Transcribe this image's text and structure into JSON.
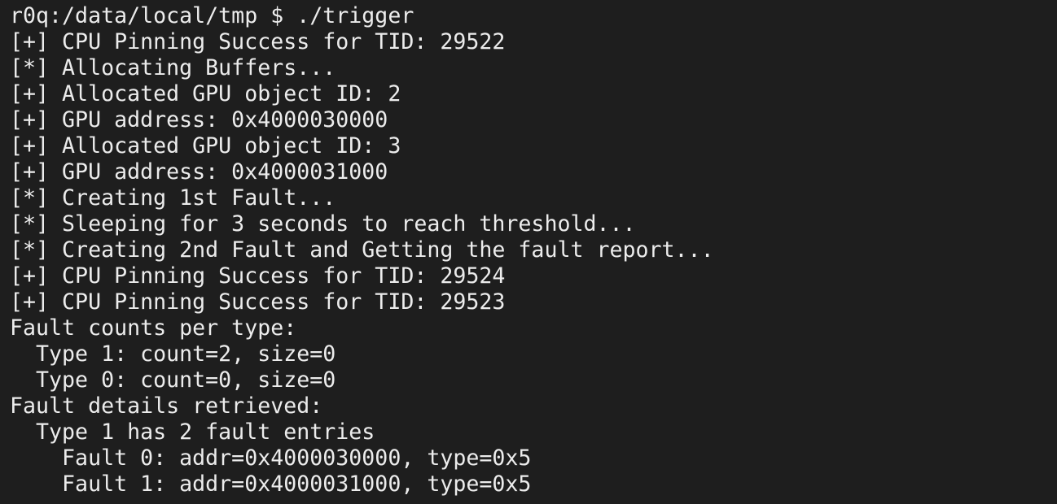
{
  "terminal": {
    "lines": [
      "r0q:/data/local/tmp $ ./trigger",
      "[+] CPU Pinning Success for TID: 29522",
      "[*] Allocating Buffers...",
      "[+] Allocated GPU object ID: 2",
      "[+] GPU address: 0x4000030000",
      "[+] Allocated GPU object ID: 3",
      "[+] GPU address: 0x4000031000",
      "[*] Creating 1st Fault...",
      "[*] Sleeping for 3 seconds to reach threshold...",
      "[*] Creating 2nd Fault and Getting the fault report...",
      "[+] CPU Pinning Success for TID: 29524",
      "[+] CPU Pinning Success for TID: 29523",
      "Fault counts per type:",
      "  Type 1: count=2, size=0",
      "  Type 0: count=0, size=0",
      "Fault details retrieved:",
      "  Type 1 has 2 fault entries",
      "    Fault 0: addr=0x4000030000, type=0x5",
      "    Fault 1: addr=0x4000031000, type=0x5"
    ]
  }
}
